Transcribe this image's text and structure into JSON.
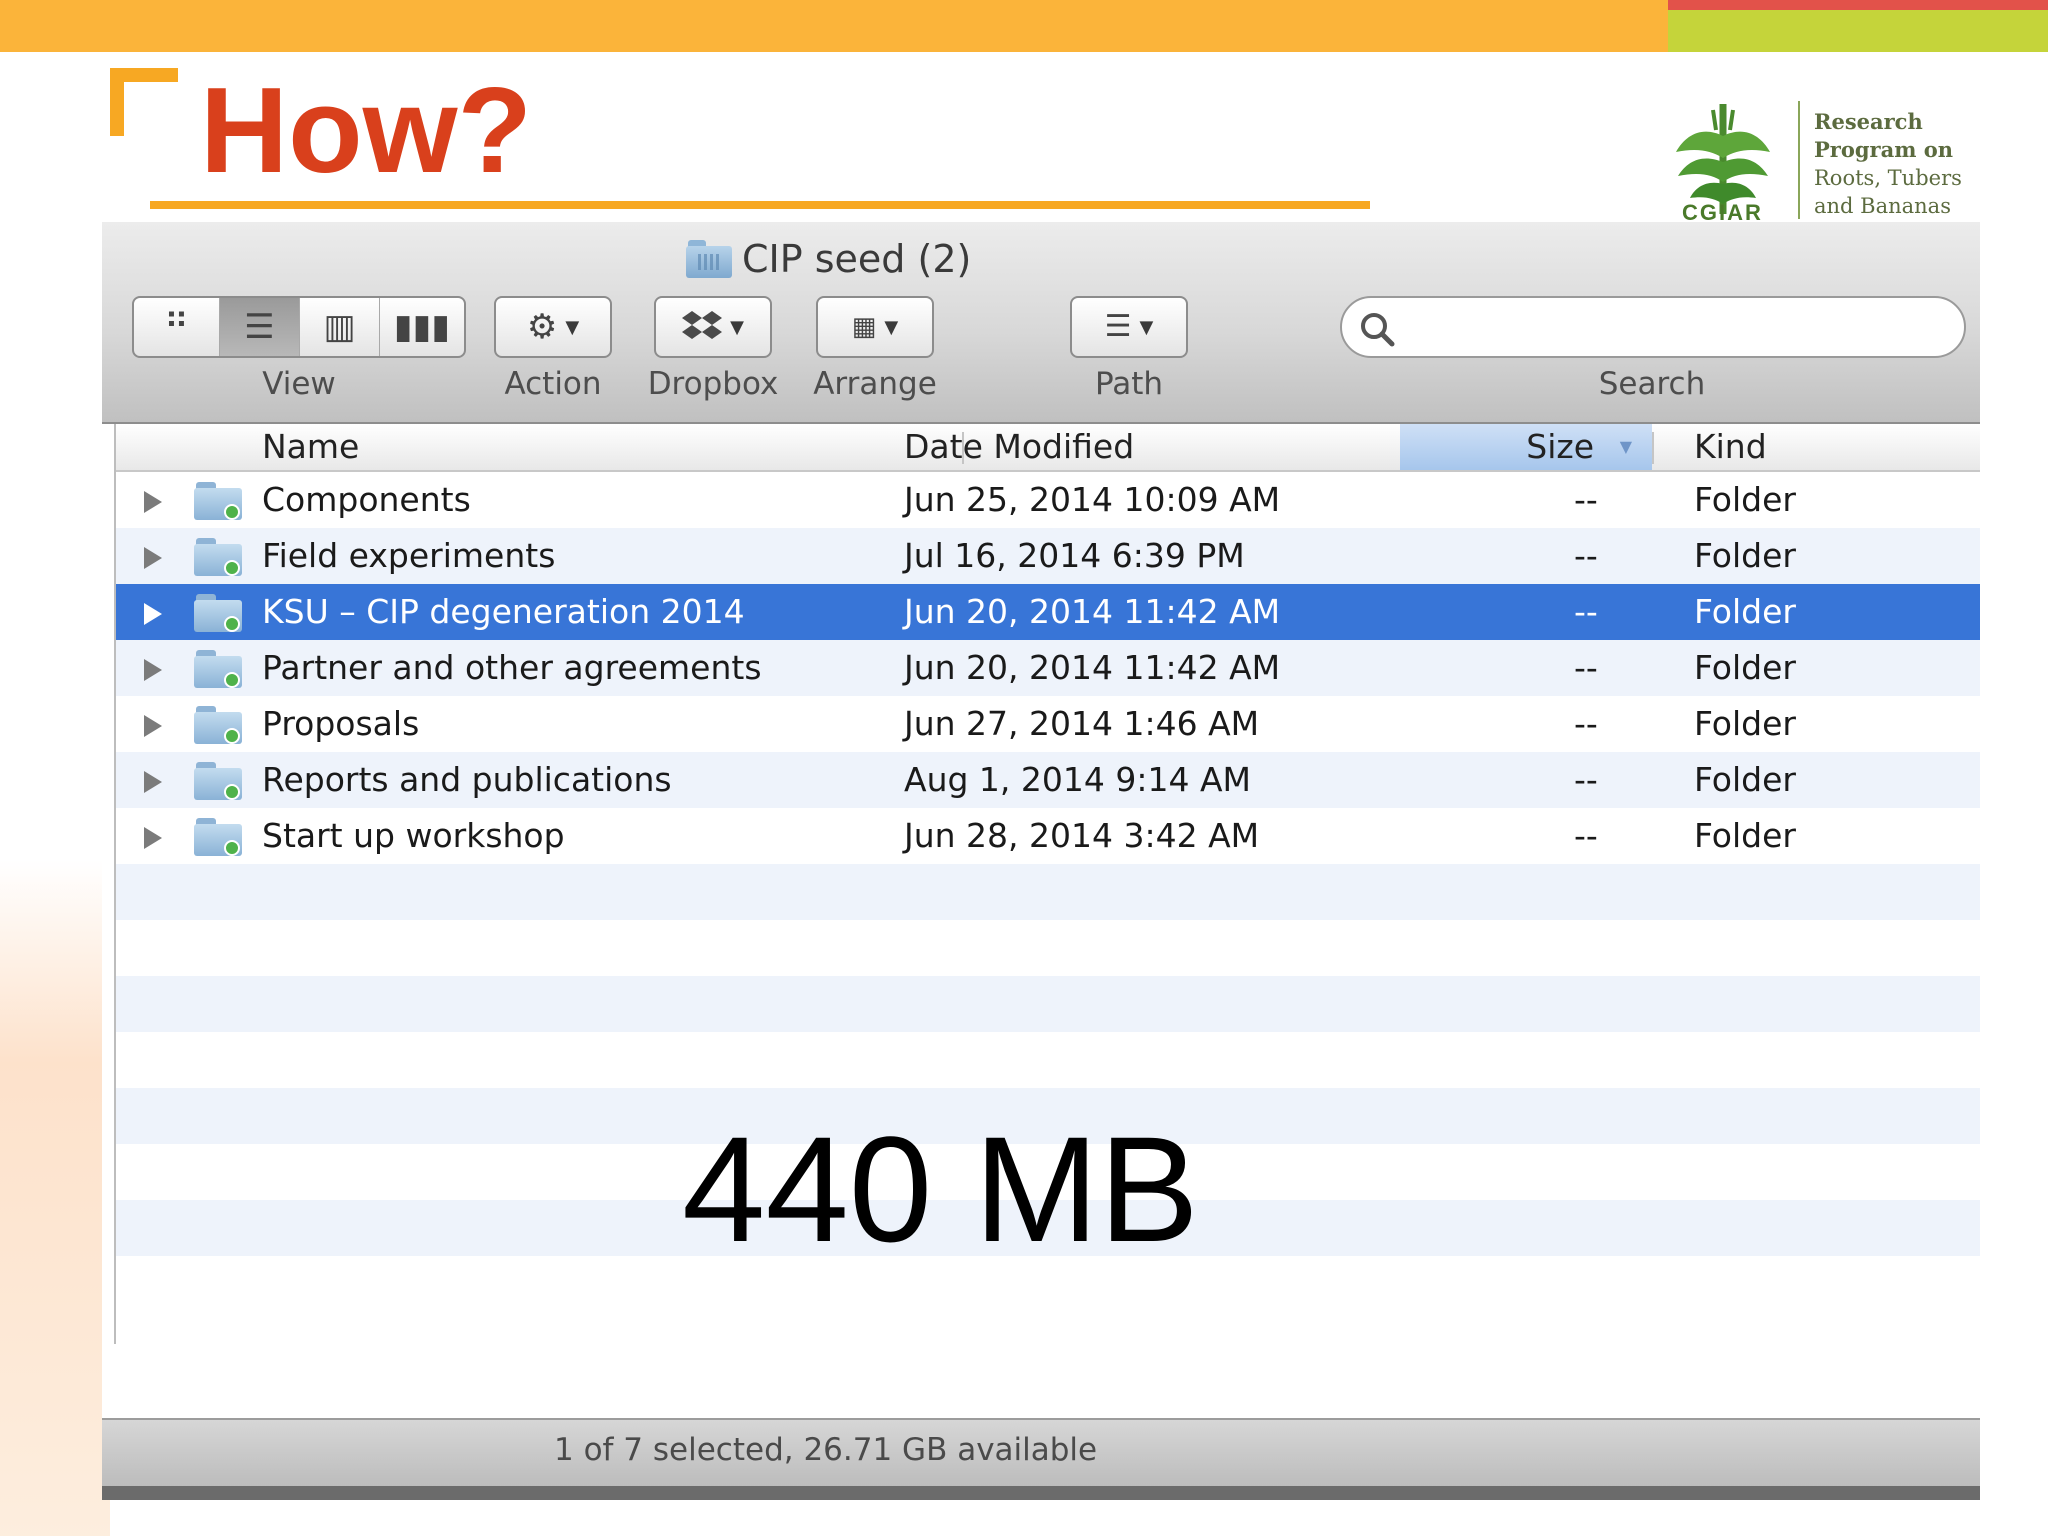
{
  "slide": {
    "title": "How?",
    "logo": {
      "line1": "Research",
      "line2": "Program on",
      "line3": "Roots, Tubers",
      "line4": "and Bananas",
      "mark": "CGIAR"
    },
    "colors": {
      "title": "#d9401c",
      "accent": "#f7a823"
    }
  },
  "window": {
    "title": "CIP seed (2)",
    "toolbar": {
      "view_label": "View",
      "action_label": "Action",
      "dropbox_label": "Dropbox",
      "arrange_label": "Arrange",
      "path_label": "Path",
      "search_label": "Search",
      "search_placeholder": "",
      "active_view": "list"
    },
    "columns": [
      "Name",
      "Date Modified",
      "Size",
      "Kind"
    ],
    "sorted_column": "Size",
    "rows": [
      {
        "name": "Components",
        "date": "Jun 25, 2014 10:09 AM",
        "size": "--",
        "kind": "Folder",
        "selected": false
      },
      {
        "name": "Field experiments",
        "date": "Jul 16, 2014 6:39 PM",
        "size": "--",
        "kind": "Folder",
        "selected": false
      },
      {
        "name": "KSU – CIP degeneration 2014",
        "date": "Jun 20, 2014 11:42 AM",
        "size": "--",
        "kind": "Folder",
        "selected": true
      },
      {
        "name": "Partner and other agreements",
        "date": "Jun 20, 2014 11:42 AM",
        "size": "--",
        "kind": "Folder",
        "selected": false
      },
      {
        "name": "Proposals",
        "date": "Jun 27, 2014 1:46 AM",
        "size": "--",
        "kind": "Folder",
        "selected": false
      },
      {
        "name": "Reports and publications",
        "date": "Aug 1, 2014 9:14 AM",
        "size": "--",
        "kind": "Folder",
        "selected": false
      },
      {
        "name": "Start up workshop",
        "date": "Jun 28, 2014 3:42 AM",
        "size": "--",
        "kind": "Folder",
        "selected": false
      }
    ],
    "overlay_size": "440 MB",
    "status": "1 of 7 selected, 26.71 GB available",
    "colors": {
      "selection": "#3875d7",
      "alt_row": "#eef3fb"
    }
  }
}
